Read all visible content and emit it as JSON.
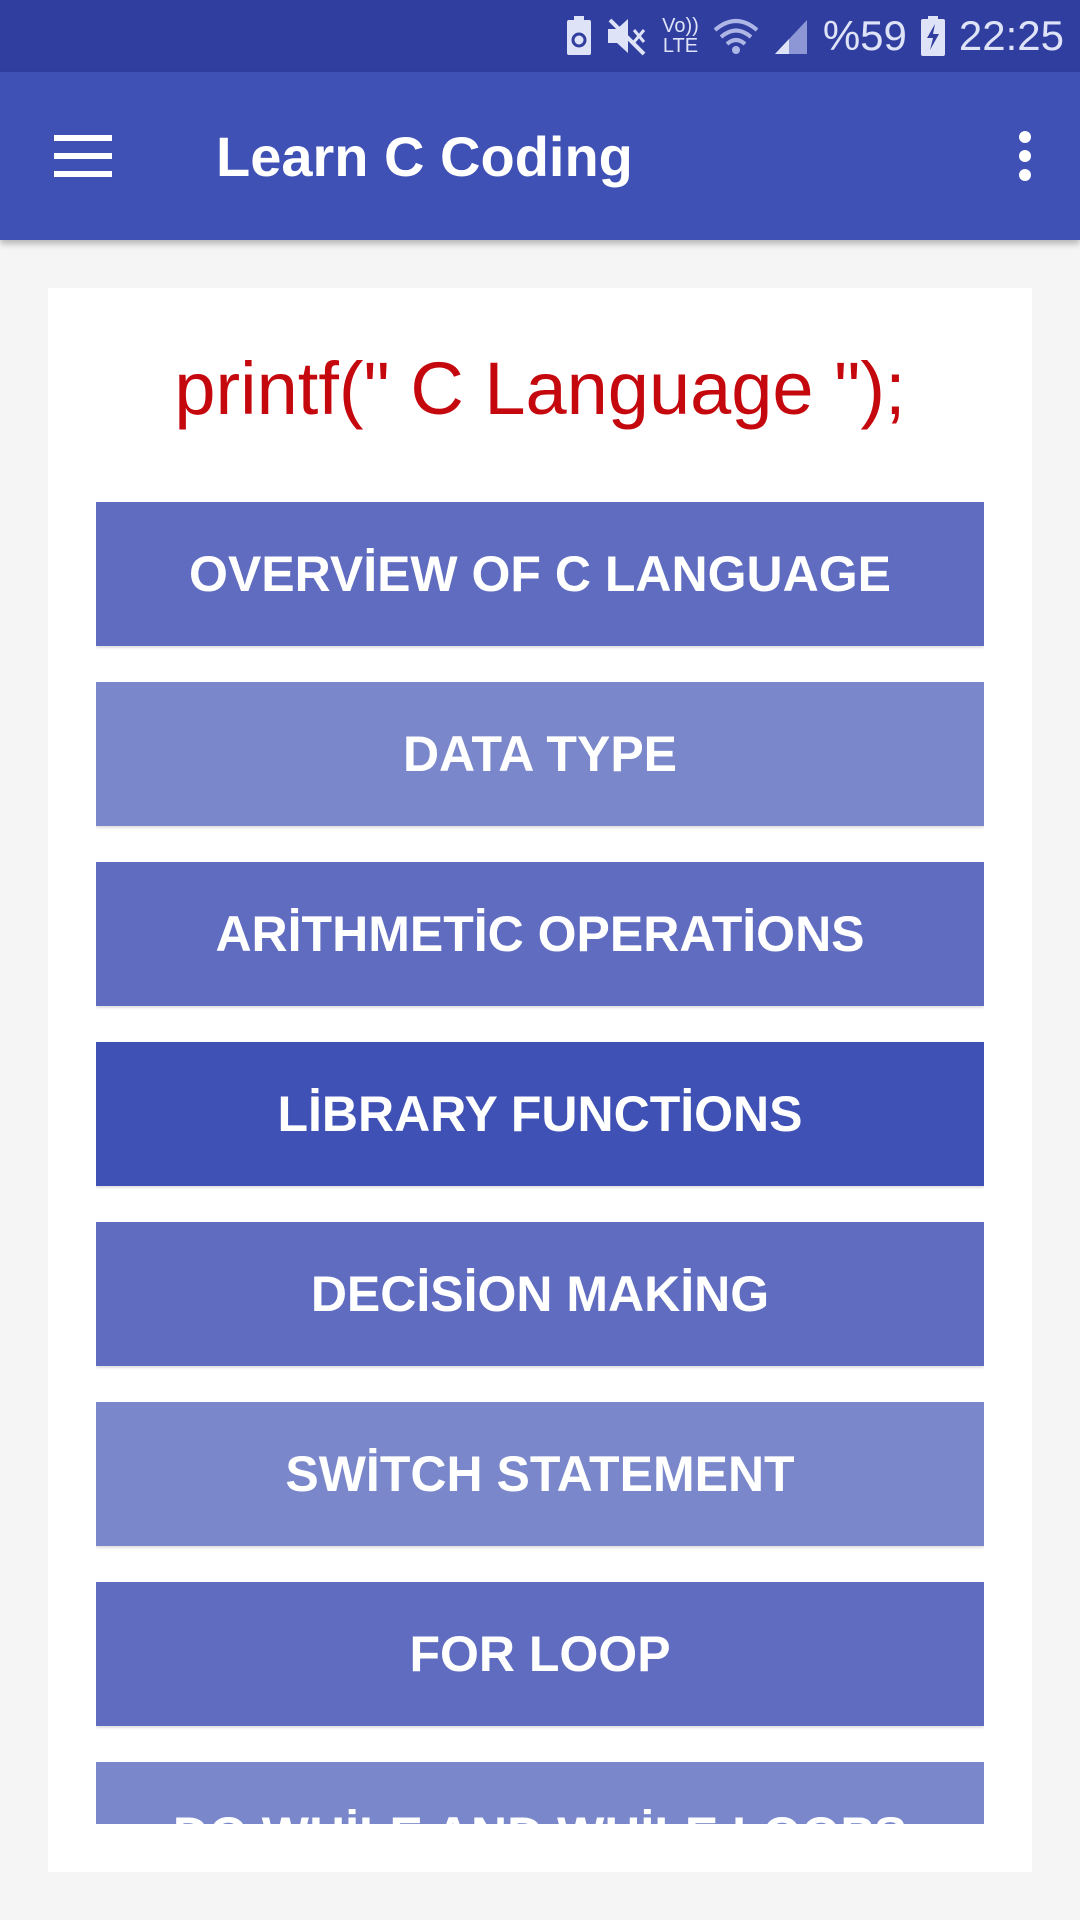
{
  "status_bar": {
    "battery_percent": "%59",
    "time": "22:25",
    "volte_label_top": "Vo))",
    "volte_label_bottom": "LTE",
    "icons": [
      "battery-saver-icon",
      "mute-icon",
      "volte-icon",
      "wifi-icon",
      "signal-icon",
      "battery-charging-icon"
    ]
  },
  "app_bar": {
    "title": "Learn C Coding",
    "menu_icon": "hamburger-menu-icon",
    "overflow_icon": "more-vert-icon",
    "color": "#3f51b5"
  },
  "main": {
    "headline": "printf(\" C Language \");",
    "headline_color": "#c4080e",
    "topics": [
      {
        "label": "OVERVİEW OF C LANGUAGE"
      },
      {
        "label": "DATA TYPE"
      },
      {
        "label": "ARİTHMETİC OPERATİONS"
      },
      {
        "label": "LİBRARY FUNCTİONS"
      },
      {
        "label": "DECİSİON MAKİNG"
      },
      {
        "label": "SWİTCH STATEMENT"
      },
      {
        "label": "FOR LOOP"
      },
      {
        "label": "DO WHİLE AND WHİLE LOOPS"
      }
    ]
  }
}
